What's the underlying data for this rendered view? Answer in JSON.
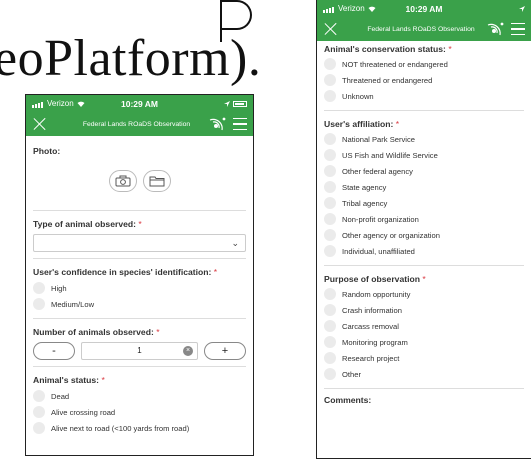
{
  "slide": {
    "title_line1": "",
    "title_line2": "eoPlatform)."
  },
  "phone1": {
    "status": {
      "carrier": "Verizon",
      "time": "10:29 AM"
    },
    "nav_title": "Federal Lands ROaDS Observation",
    "photo": {
      "label": "Photo:"
    },
    "animal_type": {
      "label": "Type of animal observed:",
      "required": "*",
      "value": ""
    },
    "confidence": {
      "label": "User's confidence in species' identification:",
      "required": "*",
      "options": [
        "High",
        "Medium/Low"
      ]
    },
    "count": {
      "label": "Number of animals observed:",
      "required": "*",
      "minus": "-",
      "value": "1",
      "plus": "+"
    },
    "status_q": {
      "label": "Animal's status:",
      "required": "*",
      "options": [
        "Dead",
        "Alive crossing road",
        "Alive next to road (<100 yards from road)"
      ]
    }
  },
  "phone2": {
    "status": {
      "carrier": "Verizon",
      "time": "10:29 AM"
    },
    "nav_title": "Federal Lands ROaDS Observation",
    "conservation": {
      "label": "Animal's conservation status:",
      "required": "*",
      "options": [
        "NOT threatened or endangered",
        "Threatened or endangered",
        "Unknown"
      ]
    },
    "affiliation": {
      "label": "User's affiliation:",
      "required": "*",
      "options": [
        "National Park Service",
        "US Fish and Wildlife Service",
        "Other federal agency",
        "State agency",
        "Tribal agency",
        "Non-profit organization",
        "Other agency or organization",
        "Individual, unaffiliated"
      ]
    },
    "purpose": {
      "label": "Purpose of observation",
      "required": "*",
      "options": [
        "Random opportunity",
        "Crash information",
        "Carcass removal",
        "Monitoring program",
        "Research project",
        "Other"
      ]
    },
    "comments": {
      "label": "Comments:"
    }
  },
  "colors": {
    "header_green": "#3aa14a",
    "required_red": "#d9363e",
    "radio_gray": "#ebebeb"
  }
}
